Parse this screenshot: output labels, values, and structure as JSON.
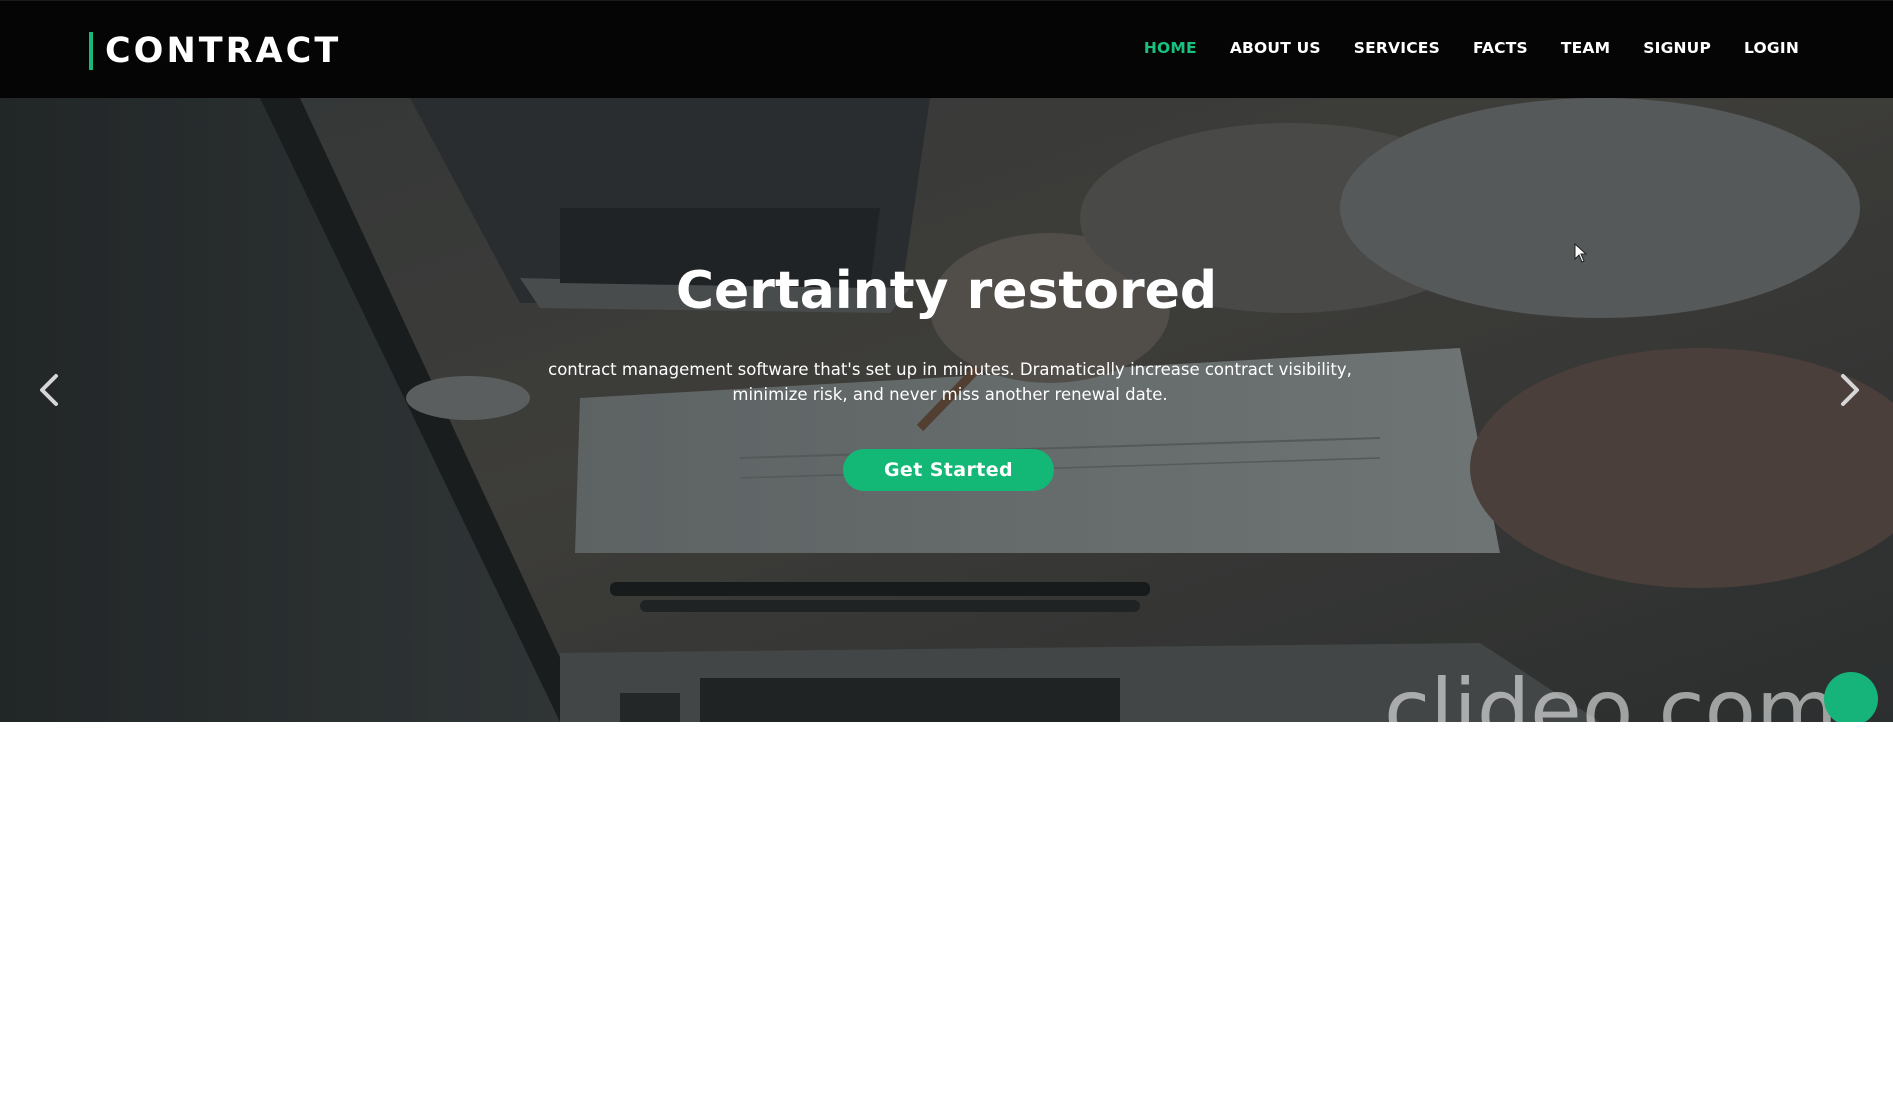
{
  "brand": {
    "name": "CONTRACT",
    "accent_color": "#18b878"
  },
  "nav": {
    "items": [
      {
        "label": "HOME",
        "active": true
      },
      {
        "label": "ABOUT US",
        "active": false
      },
      {
        "label": "SERVICES",
        "active": false
      },
      {
        "label": "FACTS",
        "active": false
      },
      {
        "label": "TEAM",
        "active": false
      },
      {
        "label": "SIGNUP",
        "active": false
      },
      {
        "label": "LOGIN",
        "active": false
      }
    ],
    "active_color": "#19c17e"
  },
  "hero": {
    "title": "Certainty restored",
    "subtitle": "contract management software that's set up in minutes. Dramatically increase contract visibility, minimize risk, and never miss another renewal date.",
    "cta_label": "Get Started",
    "prev_icon": "chevron-left-icon",
    "next_icon": "chevron-right-icon"
  },
  "watermark": {
    "text": "clideo.com"
  }
}
